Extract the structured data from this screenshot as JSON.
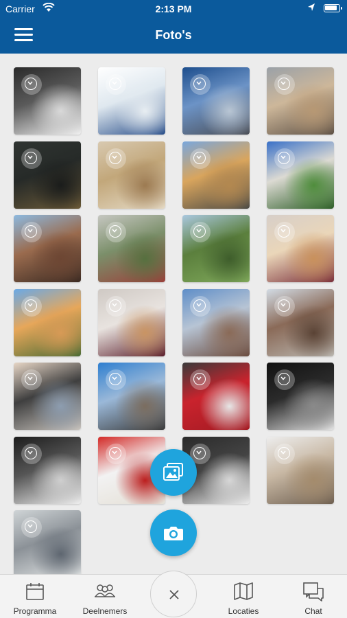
{
  "status_bar": {
    "carrier": "Carrier",
    "time": "2:13 PM"
  },
  "header": {
    "title": "Foto's",
    "menu_icon": "hamburger-menu-icon",
    "background": "#0b5a9c"
  },
  "photos": [
    {
      "desc": "keyboard and monitor",
      "colors": [
        "#2a2a2a",
        "#5a5a5a",
        "#d9d9d9",
        "#f1f1f1"
      ]
    },
    {
      "desc": "Onze vloot poster",
      "colors": [
        "#ffffff",
        "#dfe8ef",
        "#e8eef2",
        "#2a4f8a"
      ]
    },
    {
      "desc": "airplane wing view",
      "colors": [
        "#1d4e8d",
        "#6c93c6",
        "#b9c6d4",
        "#4b4e56"
      ]
    },
    {
      "desc": "building facade",
      "colors": [
        "#9aa1a8",
        "#cdb79a",
        "#b79874",
        "#5e5145"
      ]
    },
    {
      "desc": "city at night",
      "colors": [
        "#2f3431",
        "#262a28",
        "#1a1c1b",
        "#6b5a38"
      ]
    },
    {
      "desc": "glass atrium",
      "colors": [
        "#d8c9b0",
        "#c2a77a",
        "#9c7a51",
        "#e4d9c4"
      ]
    },
    {
      "desc": "yellow building",
      "colors": [
        "#7aa7dc",
        "#d9a55d",
        "#b38850",
        "#4b4a45"
      ]
    },
    {
      "desc": "lawn and building",
      "colors": [
        "#3a71c8",
        "#dcdad3",
        "#4f8d3c",
        "#2e5e28"
      ]
    },
    {
      "desc": "old buildings",
      "colors": [
        "#8db9df",
        "#9a6b4e",
        "#6d4633",
        "#3a2a22"
      ]
    },
    {
      "desc": "garden with trees",
      "colors": [
        "#c6c7c1",
        "#7b8f6a",
        "#56703f",
        "#9a3f3a"
      ]
    },
    {
      "desc": "sea view trees",
      "colors": [
        "#aac8df",
        "#5b7f3d",
        "#3e5d2b",
        "#7fa85a"
      ]
    },
    {
      "desc": "cookie on plate",
      "colors": [
        "#d7cfc9",
        "#ead6b9",
        "#c9915c",
        "#7a2f3a"
      ]
    },
    {
      "desc": "palm trees",
      "colors": [
        "#6aa9e6",
        "#e7a75a",
        "#d79a56",
        "#4a6b34"
      ]
    },
    {
      "desc": "cookie on plate 2",
      "colors": [
        "#cfc9c4",
        "#e8e3df",
        "#c99463",
        "#5b1f2c"
      ]
    },
    {
      "desc": "city panorama",
      "colors": [
        "#5f8ec8",
        "#b7c4d4",
        "#8a6a57",
        "#6a4b3e"
      ]
    },
    {
      "desc": "brick house",
      "colors": [
        "#d2dbe4",
        "#8a6a58",
        "#5a4335",
        "#b9b5ae"
      ]
    },
    {
      "desc": "street houses",
      "colors": [
        "#e7d6c6",
        "#3f3f3f",
        "#8d9db0",
        "#c8c3bd"
      ]
    },
    {
      "desc": "monument square",
      "colors": [
        "#2f7fd0",
        "#9ab8d8",
        "#7b6d5f",
        "#3b3b3b"
      ]
    },
    {
      "desc": "red napkin teapot",
      "colors": [
        "#3a3a3a",
        "#c9232d",
        "#e6e6e6",
        "#a41b23"
      ]
    },
    {
      "desc": "dark screen",
      "colors": [
        "#111111",
        "#2b2b2b",
        "#8a8a8a",
        "#e2e2e2"
      ]
    },
    {
      "desc": "desk monitor",
      "colors": [
        "#1d1d1d",
        "#555555",
        "#cfcfcf",
        "#efefef"
      ]
    },
    {
      "desc": "coca-cola cup",
      "colors": [
        "#d32a27",
        "#f2f2f2",
        "#bb1e1e",
        "#e4dfd5"
      ]
    },
    {
      "desc": "laptop keyboard",
      "colors": [
        "#2b2b2b",
        "#444444",
        "#d7d7d7",
        "#ededed"
      ]
    },
    {
      "desc": "sugar sticks cup",
      "colors": [
        "#ededed",
        "#c8b8a4",
        "#a48b6c",
        "#6e5f50"
      ]
    },
    {
      "desc": "glass bottle",
      "colors": [
        "#cfd4d6",
        "#8b9197",
        "#5e6670",
        "#e3e6e6"
      ]
    }
  ],
  "fabs": {
    "gallery_icon": "gallery-icon",
    "camera_icon": "camera-icon",
    "color": "#1fa4dd"
  },
  "tabbar": {
    "programma": "Programma",
    "deelnemers": "Deelnemers",
    "locaties": "Locaties",
    "chat": "Chat",
    "close_icon": "close-icon"
  }
}
